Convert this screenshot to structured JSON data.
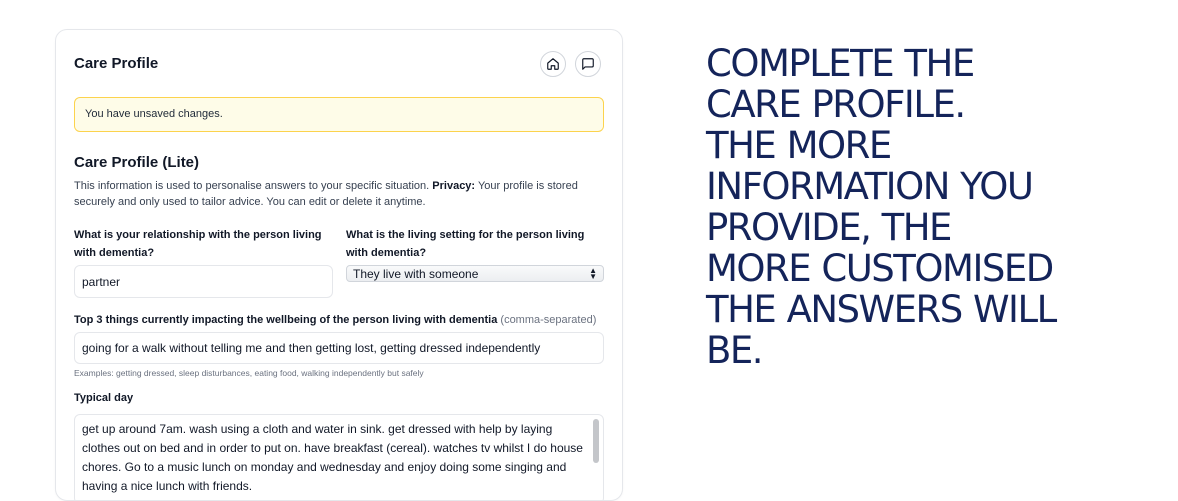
{
  "card": {
    "title": "Care Profile",
    "home_icon": "home-icon",
    "chat_icon": "message-square-icon"
  },
  "alert": {
    "text": "You have unsaved changes."
  },
  "section": {
    "title": "Care Profile (Lite)",
    "desc_main": "This information is used to personalise answers to your specific situation. ",
    "desc_privacy_label": "Privacy:",
    "desc_privacy_text": " Your profile is stored securely and only used to tailor advice. You can edit or delete it anytime."
  },
  "fields": {
    "relationship": {
      "label": "What is your relationship with the person living with dementia?",
      "value": "partner"
    },
    "living_setting": {
      "label": "What is the living setting for the person living with dementia?",
      "selected": "They live with someone"
    },
    "top_three": {
      "label": "Top 3 things currently impacting the wellbeing of the person living with dementia",
      "label_hint": "(comma-separated)",
      "value": "going for a walk without telling me and then getting lost, getting dressed independently",
      "helper": "Examples: getting dressed, sleep disturbances, eating food, walking independently but safely"
    },
    "typical_day": {
      "label": "Typical day",
      "value": "get up around 7am. wash using a cloth and water in sink. get dressed with help by laying clothes out on bed and in order to put on. have breakfast (cereal). watches tv whilst I do house chores. Go to a music lunch on monday and wednesday and enjoy doing some singing and having a nice lunch with friends."
    }
  },
  "promo": {
    "lines": [
      "COMPLETE THE",
      "CARE PROFILE.",
      "THE MORE",
      "INFORMATION YOU",
      "PROVIDE, THE",
      "MORE CUSTOMISED",
      "THE ANSWERS WILL",
      "BE."
    ]
  },
  "colors": {
    "promo_text": "#14245a",
    "alert_bg": "#fefce8",
    "alert_border": "#fcd34d"
  }
}
